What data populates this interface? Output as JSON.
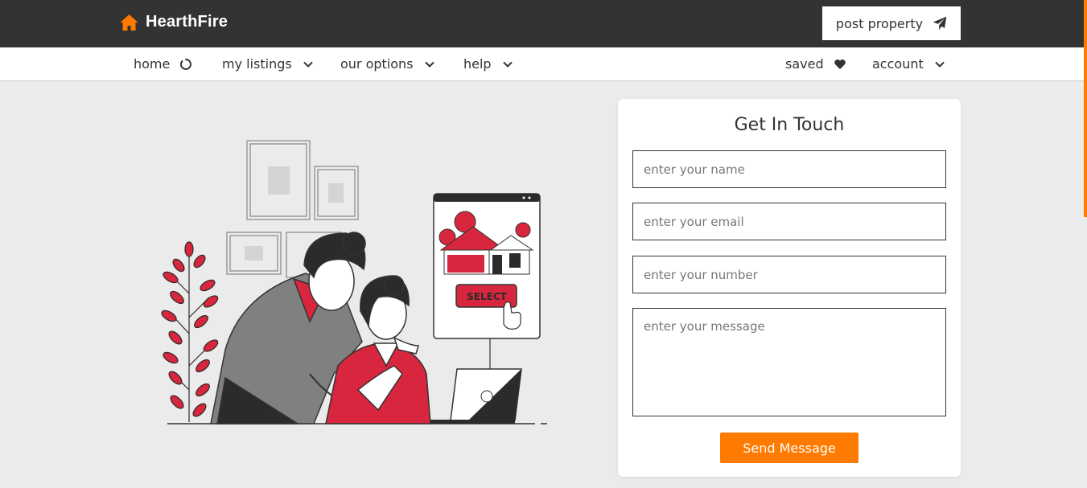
{
  "brand": {
    "name": "HearthFire",
    "logo_icon": "house-icon",
    "accent": "#ff7a00"
  },
  "header": {
    "post_property_label": "post property",
    "post_property_icon": "paper-plane-icon"
  },
  "nav": {
    "home": "home",
    "my_listings": "my listings",
    "our_options": "our options",
    "help": "help",
    "saved": "saved",
    "account": "account"
  },
  "illustration": {
    "button_text": "SELECT"
  },
  "contact_form": {
    "title": "Get In Touch",
    "name_placeholder": "enter your name",
    "email_placeholder": "enter your email",
    "number_placeholder": "enter your number",
    "message_placeholder": "enter your message",
    "submit_label": "Send Message"
  },
  "colors": {
    "topbar": "#333333",
    "accent": "#ff7a00",
    "illustration_red": "#d7263d"
  }
}
